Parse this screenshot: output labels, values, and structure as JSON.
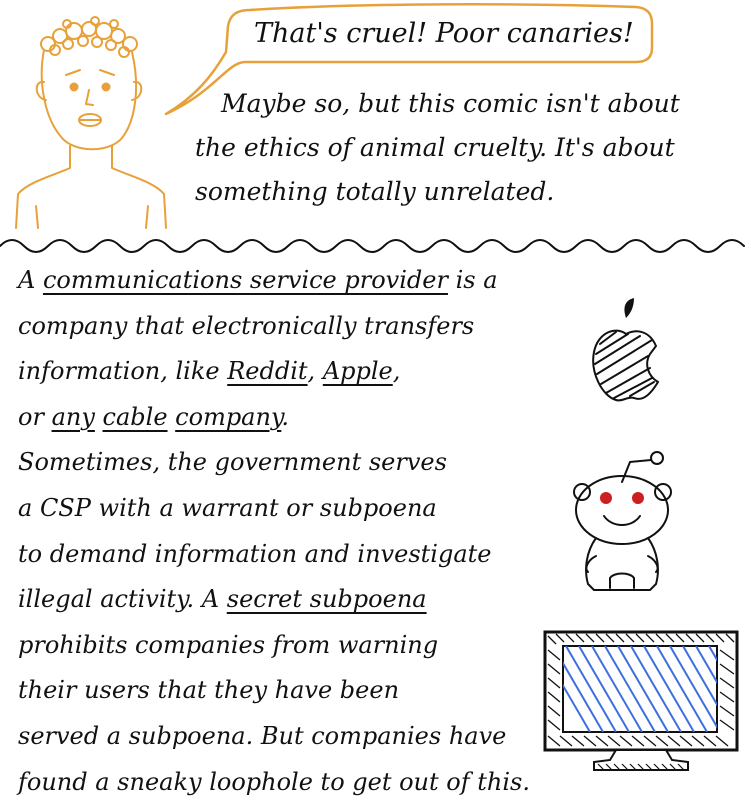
{
  "speech_bubble": {
    "text": "That's cruel! Poor canaries!"
  },
  "narration": {
    "line1": "Maybe so, but this comic isn't about",
    "line2": "the ethics of animal cruelty. It's about",
    "line3": "something totally unrelated."
  },
  "body": {
    "l1_a": "A ",
    "csp_term": "communications service provider",
    "l1_b": " is a",
    "l2": "company that electronically transfers",
    "l3_a": "information, like ",
    "reddit": "Reddit",
    "l3_b": ", ",
    "apple": "Apple",
    "l3_c": ",",
    "l4_a": "or ",
    "any": "any",
    "cable": "cable",
    "company": "company",
    "l4_b": ".",
    "l5": "Sometimes, the government serves",
    "l6": "a CSP with a warrant or subpoena",
    "l7": "to demand information and investigate",
    "l8_a": "illegal activity. A ",
    "secret_subpoena": "secret subpoena",
    "l9": "prohibits companies from warning",
    "l10": "their users that they have been",
    "l11": "served a subpoena. But companies have",
    "l12": "found a sneaky loophole to get out of this."
  },
  "colors": {
    "ink": "#111111",
    "character": "#e8a13a",
    "screen": "#3d6fe0",
    "reddit_eyes": "#cc1f1f"
  },
  "icons": [
    "apple-logo-icon",
    "reddit-alien-icon",
    "tv-monitor-icon"
  ]
}
